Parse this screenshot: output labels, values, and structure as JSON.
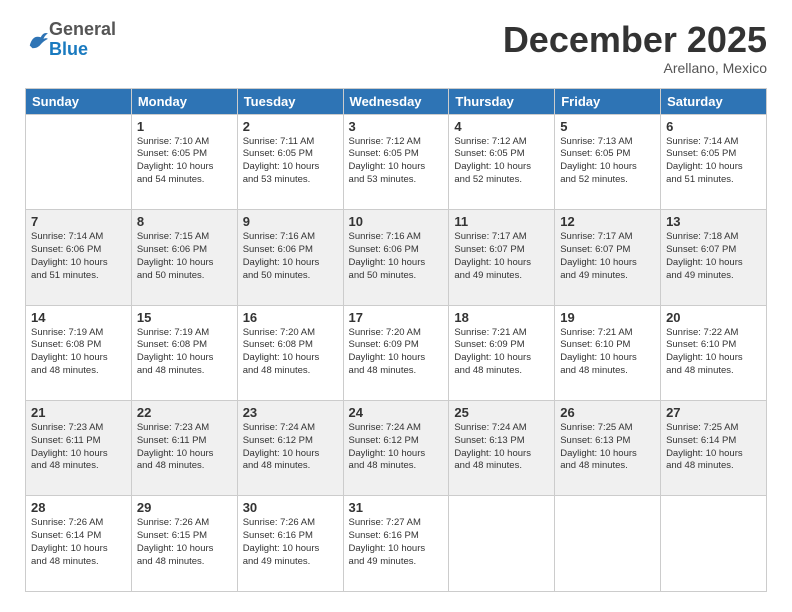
{
  "logo": {
    "general": "General",
    "blue": "Blue"
  },
  "header": {
    "month": "December 2025",
    "location": "Arellano, Mexico"
  },
  "weekdays": [
    "Sunday",
    "Monday",
    "Tuesday",
    "Wednesday",
    "Thursday",
    "Friday",
    "Saturday"
  ],
  "weeks": [
    [
      {
        "day": "",
        "info": ""
      },
      {
        "day": "1",
        "info": "Sunrise: 7:10 AM\nSunset: 6:05 PM\nDaylight: 10 hours\nand 54 minutes."
      },
      {
        "day": "2",
        "info": "Sunrise: 7:11 AM\nSunset: 6:05 PM\nDaylight: 10 hours\nand 53 minutes."
      },
      {
        "day": "3",
        "info": "Sunrise: 7:12 AM\nSunset: 6:05 PM\nDaylight: 10 hours\nand 53 minutes."
      },
      {
        "day": "4",
        "info": "Sunrise: 7:12 AM\nSunset: 6:05 PM\nDaylight: 10 hours\nand 52 minutes."
      },
      {
        "day": "5",
        "info": "Sunrise: 7:13 AM\nSunset: 6:05 PM\nDaylight: 10 hours\nand 52 minutes."
      },
      {
        "day": "6",
        "info": "Sunrise: 7:14 AM\nSunset: 6:05 PM\nDaylight: 10 hours\nand 51 minutes."
      }
    ],
    [
      {
        "day": "7",
        "info": "Sunrise: 7:14 AM\nSunset: 6:06 PM\nDaylight: 10 hours\nand 51 minutes."
      },
      {
        "day": "8",
        "info": "Sunrise: 7:15 AM\nSunset: 6:06 PM\nDaylight: 10 hours\nand 50 minutes."
      },
      {
        "day": "9",
        "info": "Sunrise: 7:16 AM\nSunset: 6:06 PM\nDaylight: 10 hours\nand 50 minutes."
      },
      {
        "day": "10",
        "info": "Sunrise: 7:16 AM\nSunset: 6:06 PM\nDaylight: 10 hours\nand 50 minutes."
      },
      {
        "day": "11",
        "info": "Sunrise: 7:17 AM\nSunset: 6:07 PM\nDaylight: 10 hours\nand 49 minutes."
      },
      {
        "day": "12",
        "info": "Sunrise: 7:17 AM\nSunset: 6:07 PM\nDaylight: 10 hours\nand 49 minutes."
      },
      {
        "day": "13",
        "info": "Sunrise: 7:18 AM\nSunset: 6:07 PM\nDaylight: 10 hours\nand 49 minutes."
      }
    ],
    [
      {
        "day": "14",
        "info": "Sunrise: 7:19 AM\nSunset: 6:08 PM\nDaylight: 10 hours\nand 48 minutes."
      },
      {
        "day": "15",
        "info": "Sunrise: 7:19 AM\nSunset: 6:08 PM\nDaylight: 10 hours\nand 48 minutes."
      },
      {
        "day": "16",
        "info": "Sunrise: 7:20 AM\nSunset: 6:08 PM\nDaylight: 10 hours\nand 48 minutes."
      },
      {
        "day": "17",
        "info": "Sunrise: 7:20 AM\nSunset: 6:09 PM\nDaylight: 10 hours\nand 48 minutes."
      },
      {
        "day": "18",
        "info": "Sunrise: 7:21 AM\nSunset: 6:09 PM\nDaylight: 10 hours\nand 48 minutes."
      },
      {
        "day": "19",
        "info": "Sunrise: 7:21 AM\nSunset: 6:10 PM\nDaylight: 10 hours\nand 48 minutes."
      },
      {
        "day": "20",
        "info": "Sunrise: 7:22 AM\nSunset: 6:10 PM\nDaylight: 10 hours\nand 48 minutes."
      }
    ],
    [
      {
        "day": "21",
        "info": "Sunrise: 7:23 AM\nSunset: 6:11 PM\nDaylight: 10 hours\nand 48 minutes."
      },
      {
        "day": "22",
        "info": "Sunrise: 7:23 AM\nSunset: 6:11 PM\nDaylight: 10 hours\nand 48 minutes."
      },
      {
        "day": "23",
        "info": "Sunrise: 7:24 AM\nSunset: 6:12 PM\nDaylight: 10 hours\nand 48 minutes."
      },
      {
        "day": "24",
        "info": "Sunrise: 7:24 AM\nSunset: 6:12 PM\nDaylight: 10 hours\nand 48 minutes."
      },
      {
        "day": "25",
        "info": "Sunrise: 7:24 AM\nSunset: 6:13 PM\nDaylight: 10 hours\nand 48 minutes."
      },
      {
        "day": "26",
        "info": "Sunrise: 7:25 AM\nSunset: 6:13 PM\nDaylight: 10 hours\nand 48 minutes."
      },
      {
        "day": "27",
        "info": "Sunrise: 7:25 AM\nSunset: 6:14 PM\nDaylight: 10 hours\nand 48 minutes."
      }
    ],
    [
      {
        "day": "28",
        "info": "Sunrise: 7:26 AM\nSunset: 6:14 PM\nDaylight: 10 hours\nand 48 minutes."
      },
      {
        "day": "29",
        "info": "Sunrise: 7:26 AM\nSunset: 6:15 PM\nDaylight: 10 hours\nand 48 minutes."
      },
      {
        "day": "30",
        "info": "Sunrise: 7:26 AM\nSunset: 6:16 PM\nDaylight: 10 hours\nand 49 minutes."
      },
      {
        "day": "31",
        "info": "Sunrise: 7:27 AM\nSunset: 6:16 PM\nDaylight: 10 hours\nand 49 minutes."
      },
      {
        "day": "",
        "info": ""
      },
      {
        "day": "",
        "info": ""
      },
      {
        "day": "",
        "info": ""
      }
    ]
  ]
}
